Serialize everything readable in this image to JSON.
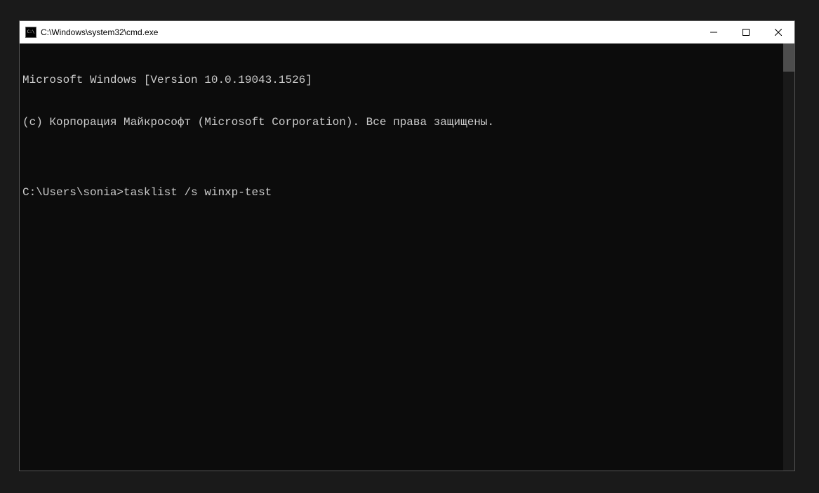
{
  "titlebar": {
    "title": "C:\\Windows\\system32\\cmd.exe"
  },
  "terminal": {
    "line1": "Microsoft Windows [Version 10.0.19043.1526]",
    "line2": "(c) Корпорация Майкрософт (Microsoft Corporation). Все права защищены.",
    "blank": "",
    "prompt": "C:\\Users\\sonia>",
    "command": "tasklist /s winxp-test"
  }
}
